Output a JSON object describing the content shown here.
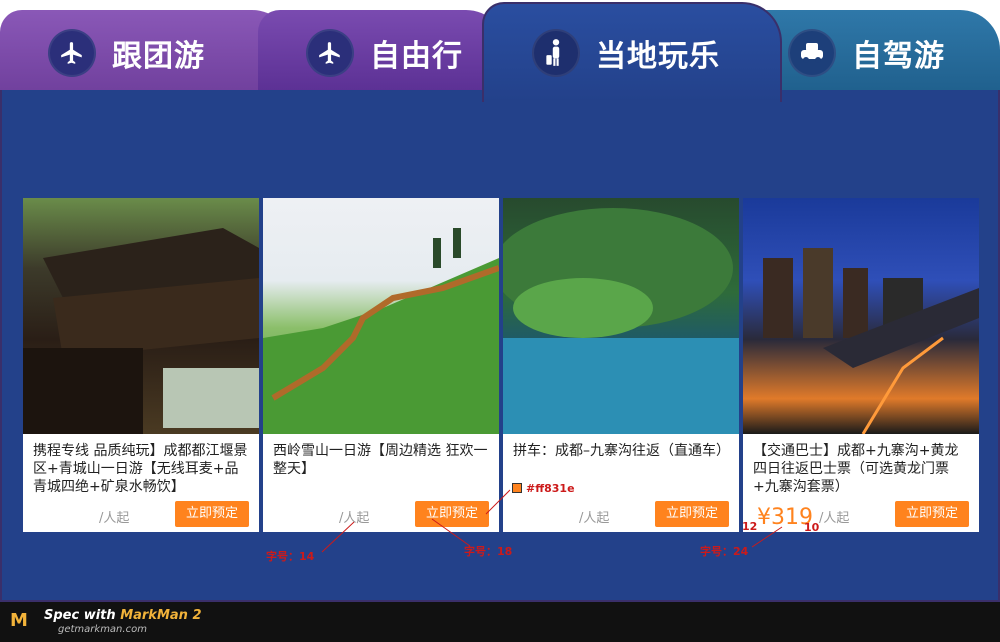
{
  "tabs": [
    {
      "label": "跟团游",
      "icon": "airplane-icon"
    },
    {
      "label": "自由行",
      "icon": "airplane-icon"
    },
    {
      "label": "当地玩乐",
      "icon": "traveler-icon"
    },
    {
      "label": "自驾游",
      "icon": "car-icon"
    }
  ],
  "cards": [
    {
      "title": "携程专线  品质纯玩】成都都江堰景区+青城山一日游【无线耳麦+品青城四绝+矿泉水畅饮】",
      "per": "/人起",
      "button": "立即预定"
    },
    {
      "title": "西岭雪山一日游【周边精选  狂欢一整天】",
      "per": "/人起",
      "button": "立即预定"
    },
    {
      "title": "拼车：成都–九寨沟往返（直通车）",
      "per": "/人起",
      "button": "立即预定"
    },
    {
      "title": "【交通巴士】成都+九寨沟+黄龙四日往返巴士票（可选黄龙门票+九寨沟套票）",
      "price": "¥319",
      "per": "/人起",
      "button": "立即预定"
    }
  ],
  "annotations": {
    "font14": "字号：14",
    "font18": "字号：18",
    "font24": "字号：24",
    "color": "#ff831e",
    "n12": "12",
    "n10": "10"
  },
  "footer": {
    "line1a": "Spec with ",
    "line1b": "MarkMan 2",
    "line2": "getmarkman.com"
  },
  "colors": {
    "accent": "#ff831e",
    "panel": "#23418a"
  }
}
